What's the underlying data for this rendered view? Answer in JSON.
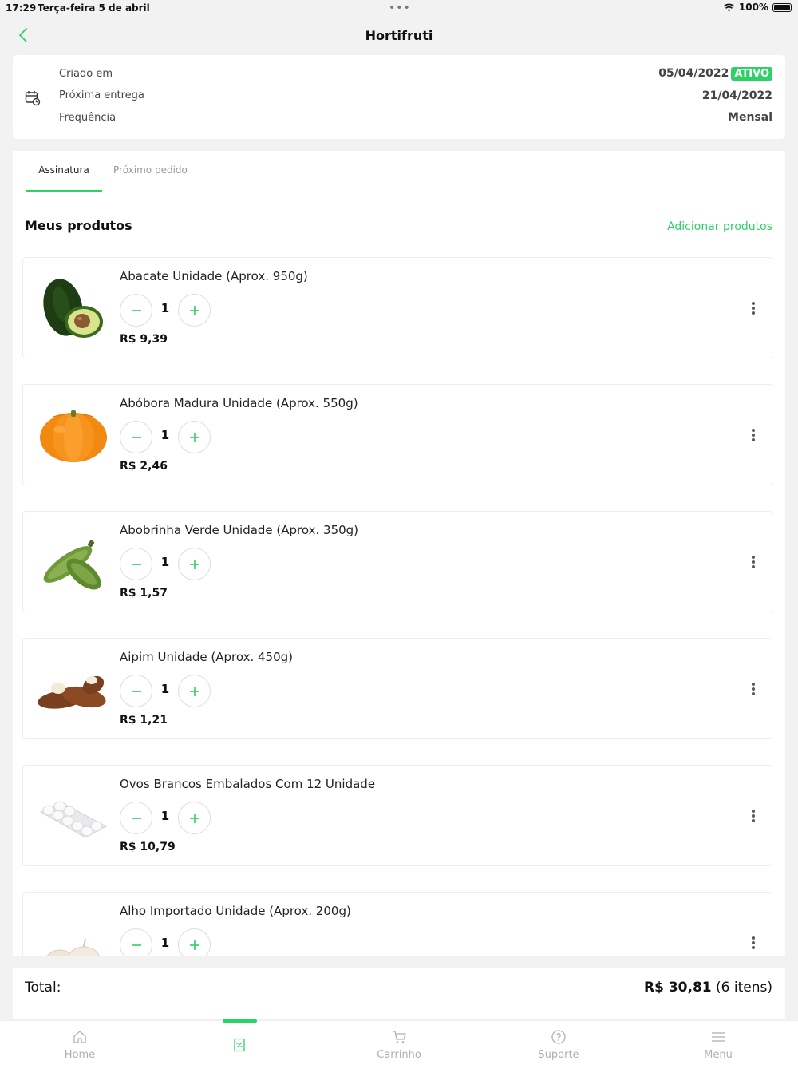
{
  "status_bar": {
    "time": "17:29",
    "date": "Terça-feira 5 de abril",
    "battery": "100%"
  },
  "header": {
    "title": "Hortifruti"
  },
  "subscription": {
    "created_label": "Criado em",
    "created_value": "05/04/2022",
    "status_badge": "ATIVO",
    "next_delivery_label": "Próxima entrega",
    "next_delivery_value": "21/04/2022",
    "frequency_label": "Frequência",
    "frequency_value": "Mensal"
  },
  "tabs": [
    {
      "label": "Assinatura",
      "active": true
    },
    {
      "label": "Próximo pedido",
      "active": false
    }
  ],
  "products_section": {
    "title": "Meus produtos",
    "add_label": "Adicionar produtos",
    "items": [
      {
        "name": "Abacate Unidade (Aprox. 950g)",
        "qty": "1",
        "price": "R$ 9,39",
        "image": "avocado-image"
      },
      {
        "name": "Abóbora Madura Unidade (Aprox. 550g)",
        "qty": "1",
        "price": "R$ 2,46",
        "image": "pumpkin-image"
      },
      {
        "name": "Abobrinha Verde Unidade (Aprox. 350g)",
        "qty": "1",
        "price": "R$ 1,57",
        "image": "zucchini-image"
      },
      {
        "name": "Aipim Unidade (Aprox. 450g)",
        "qty": "1",
        "price": "R$ 1,21",
        "image": "cassava-image"
      },
      {
        "name": "Ovos Brancos Embalados Com 12 Unidade",
        "qty": "1",
        "price": "R$ 10,79",
        "image": "eggs-image"
      },
      {
        "name": "Alho Importado Unidade (Aprox. 200g)",
        "qty": "1",
        "price": "",
        "image": "garlic-image"
      }
    ]
  },
  "total": {
    "label": "Total:",
    "amount": "R$ 30,81",
    "count": "(6 itens)"
  },
  "tab_bar": {
    "items": [
      {
        "label": "Home",
        "icon": "home-icon"
      },
      {
        "label": "",
        "icon": "subscription-icon",
        "active": true
      },
      {
        "label": "Carrinho",
        "icon": "cart-icon"
      },
      {
        "label": "Suporte",
        "icon": "support-icon"
      },
      {
        "label": "Menu",
        "icon": "menu-icon"
      }
    ]
  },
  "colors": {
    "accent": "#2dd166",
    "background": "#f2f2f2",
    "card": "#ffffff"
  }
}
